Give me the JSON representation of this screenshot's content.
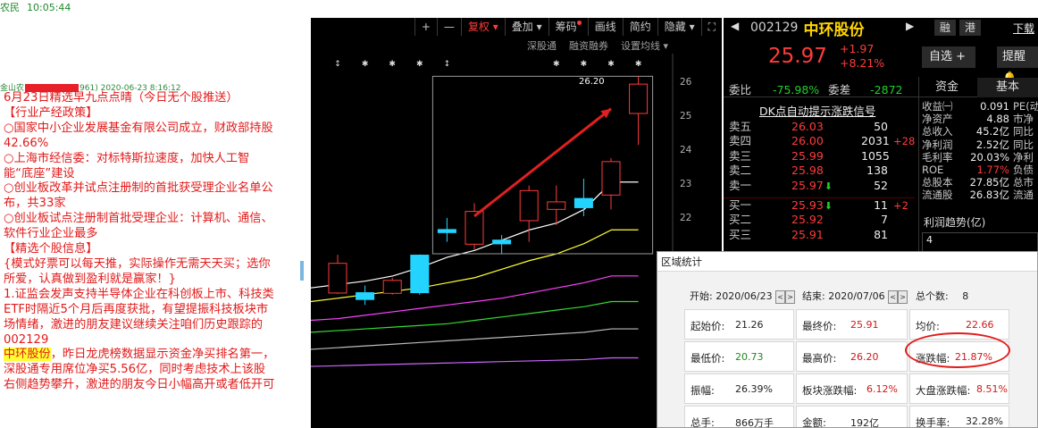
{
  "status_bar": {
    "app": "农民",
    "time": "10:05:44"
  },
  "message": {
    "sender_prefix": "金山农",
    "sender_suffix": "961)",
    "timestamp": "2020-06-23 8:16:12",
    "lines": [
      "6月23日精选早九点点晴（今日无个股推送）",
      "【行业产经政策】",
      "○国家中小企业发展基金有限公司成立，财政部持股42.66%",
      "○上海市经信委：对标特斯拉速度，加快人工智能“底座”建设",
      "○创业板改革并试点注册制的首批获受理企业名单公布，共33家",
      "○创业板试点注册制首批受理企业：计算机、通信、软件行业企业最多",
      "【精选个股信息】",
      "{模式好票可以每天推，实际操作无需天天买；选你所爱，认真做到盈利就是赢家！}",
      "1.证监会发声支持半导体企业在科创板上市、科技类ETF时隔近5个月后再度获批，有望提振科技板块市场情绪，激进的朋友建议继续关注咱们历史跟踪的002129"
    ],
    "highlight": "中环股份",
    "tail": "，昨日龙虎榜数据显示资金净买排名第一，深股通专用席位净买5.56亿，同时考虑技术上该股右侧趋势攀升，激进的朋友今日小幅高开或者低开可"
  },
  "toolbar": {
    "plus": "+",
    "minus": "—",
    "fuquan": "复权",
    "diejia": "叠加",
    "chouma": "筹码",
    "huaxian": "画线",
    "jianyue": "简约",
    "yincang": "隐藏",
    "fullscreen": "⛶"
  },
  "subtabs": {
    "sgt": "深股通",
    "rzrq": "融资融券",
    "settings": "设置均线"
  },
  "chart_data": {
    "type": "candlestick",
    "x_order": "oldest to newest",
    "price_axis_ticks": [
      26.0,
      25.0,
      24.0,
      23.0,
      22.0
    ],
    "peak_label": "26.20",
    "candles": [
      {
        "open": 19.85,
        "close": 20.72,
        "high": 20.97,
        "low": 19.82
      },
      {
        "open": 19.86,
        "close": 19.66,
        "high": 20.07,
        "low": 19.5
      },
      {
        "open": 19.84,
        "close": 20.22,
        "high": 20.3,
        "low": 19.8
      },
      {
        "open": 20.96,
        "close": 19.86,
        "high": 20.98,
        "low": 19.8
      },
      {
        "open": 21.71,
        "close": 21.62,
        "high": 22.05,
        "low": 21.35
      },
      {
        "open": 21.28,
        "close": 22.24,
        "high": 22.48,
        "low": 21.12
      },
      {
        "open": 21.4,
        "close": 21.29,
        "high": 21.55,
        "low": 21.0
      },
      {
        "open": 21.97,
        "close": 22.85,
        "high": 23.0,
        "low": 21.35
      },
      {
        "open": 22.3,
        "close": 22.52,
        "high": 23.0,
        "low": 21.84
      },
      {
        "open": 22.62,
        "close": 22.35,
        "high": 23.2,
        "low": 22.1
      },
      {
        "open": 22.72,
        "close": 23.7,
        "high": 23.8,
        "low": 22.3
      },
      {
        "open": 25.11,
        "close": 25.97,
        "high": 26.2,
        "low": 24.19
      }
    ],
    "moving_averages": [
      {
        "color": "#ffffff",
        "values": [
          20.0,
          20.1,
          20.2,
          20.35,
          20.6,
          20.9,
          21.1,
          21.4,
          21.7,
          21.9,
          22.3,
          23.1
        ]
      },
      {
        "color": "#ffff33",
        "values": [
          19.6,
          19.7,
          19.8,
          19.9,
          20.0,
          20.15,
          20.3,
          20.55,
          20.8,
          21.0,
          21.3,
          21.7
        ]
      },
      {
        "color": "#ff40ff",
        "values": [
          19.05,
          19.1,
          19.2,
          19.3,
          19.4,
          19.5,
          19.6,
          19.7,
          19.85,
          20.0,
          20.15,
          20.35
        ]
      },
      {
        "color": "#33dd33",
        "values": [
          18.7,
          18.75,
          18.8,
          18.85,
          18.9,
          18.95,
          19.05,
          19.15,
          19.25,
          19.35,
          19.45,
          19.6
        ]
      },
      {
        "color": "#bbbbbb",
        "values": [
          18.2,
          18.25,
          18.3,
          18.35,
          18.4,
          18.45,
          18.5,
          18.55,
          18.6,
          18.65,
          18.7,
          18.8
        ]
      },
      {
        "color": "#cc66ff",
        "values": [
          17.7,
          17.72,
          17.74,
          17.76,
          17.78,
          17.8,
          17.82,
          17.84,
          17.86,
          17.88,
          17.9,
          17.95
        ]
      }
    ],
    "selection_range": {
      "from_candle": 4,
      "to_candle": 11
    },
    "colors": {
      "up": "#ff3b3b",
      "down": "#22d4ff",
      "arrow": "#e02020",
      "background": "#000000"
    }
  },
  "quote": {
    "code": "002129",
    "name": "中环股份",
    "rong": "融",
    "gang": "港",
    "xiadan": "下载",
    "price": "25.97",
    "change": "+1.97",
    "change_pct": "+8.21%",
    "zixuan": "自选 +",
    "tixing": "提醒",
    "weibi_label": "委比",
    "weibi": "-75.98%",
    "weicha_label": "委差",
    "weicha": "-2872",
    "tab_zijin": "资金",
    "tab_jiben": "基本",
    "dk_link": "DK点自动提示涨跌信号",
    "orderbook": [
      {
        "label": "卖五",
        "price": "26.03",
        "vol": "50",
        "diff": ""
      },
      {
        "label": "卖四",
        "price": "26.00",
        "vol": "2031",
        "diff": "+28"
      },
      {
        "label": "卖三",
        "price": "25.99",
        "vol": "1055",
        "diff": ""
      },
      {
        "label": "卖二",
        "price": "25.98",
        "vol": "138",
        "diff": ""
      },
      {
        "label": "卖一",
        "price": "25.97",
        "vol": "52",
        "diff": "",
        "arrow": "⬇"
      },
      {
        "label": "买一",
        "price": "25.93",
        "vol": "11",
        "diff": "+2",
        "arrow": "⬇"
      },
      {
        "label": "买二",
        "price": "25.92",
        "vol": "7",
        "diff": ""
      },
      {
        "label": "买三",
        "price": "25.91",
        "vol": "81",
        "diff": ""
      }
    ],
    "fundamentals": [
      {
        "label": "收益㈠",
        "value": "0.091",
        "red": false,
        "l2": "PE(动"
      },
      {
        "label": "净资产",
        "value": "4.88",
        "red": false,
        "l2": "市净"
      },
      {
        "label": "总收入",
        "value": "45.2亿",
        "red": false,
        "l2": "同比"
      },
      {
        "label": "净利润",
        "value": "2.52亿",
        "red": false,
        "l2": "同比"
      },
      {
        "label": "毛利率",
        "value": "20.03%",
        "red": false,
        "l2": "净利"
      },
      {
        "label": "ROE",
        "value": "1.77%",
        "red": true,
        "l2": "负债"
      },
      {
        "label": "总股本",
        "value": "27.85亿",
        "red": false,
        "l2": "总市"
      },
      {
        "label": "流通股",
        "value": "26.83亿",
        "red": false,
        "l2": "流通"
      }
    ],
    "lrqs": "利润趋势(亿)",
    "cut_value": "4"
  },
  "dialog": {
    "title": "区域统计",
    "start_label": "开始:",
    "start_date": "2020/06/23",
    "end_label": "结束:",
    "end_date": "2020/07/06",
    "count_label": "总个数:",
    "count": "8",
    "stats": [
      {
        "label": "起始价:",
        "value": "21.26",
        "color": "dark"
      },
      {
        "label": "最终价:",
        "value": "25.91",
        "color": "red"
      },
      {
        "label": "均价:",
        "value": "22.66",
        "color": "red"
      },
      {
        "label": "最低价:",
        "value": "20.73",
        "color": "green"
      },
      {
        "label": "最高价:",
        "value": "26.20",
        "color": "red"
      },
      {
        "label": "涨跌幅:",
        "value": "21.87%",
        "color": "red"
      },
      {
        "label": "振幅:",
        "value": "26.39%",
        "color": "dark"
      },
      {
        "label": "板块涨跌幅:",
        "value": "6.12%",
        "color": "red"
      },
      {
        "label": "大盘涨跌幅:",
        "value": "8.51%",
        "color": "red"
      },
      {
        "label": "总手:",
        "value": "866万手",
        "color": "dark"
      },
      {
        "label": "金额:",
        "value": "192亿",
        "color": "dark"
      },
      {
        "label": "换手率:",
        "value": "32.28%",
        "color": "dark"
      }
    ]
  }
}
